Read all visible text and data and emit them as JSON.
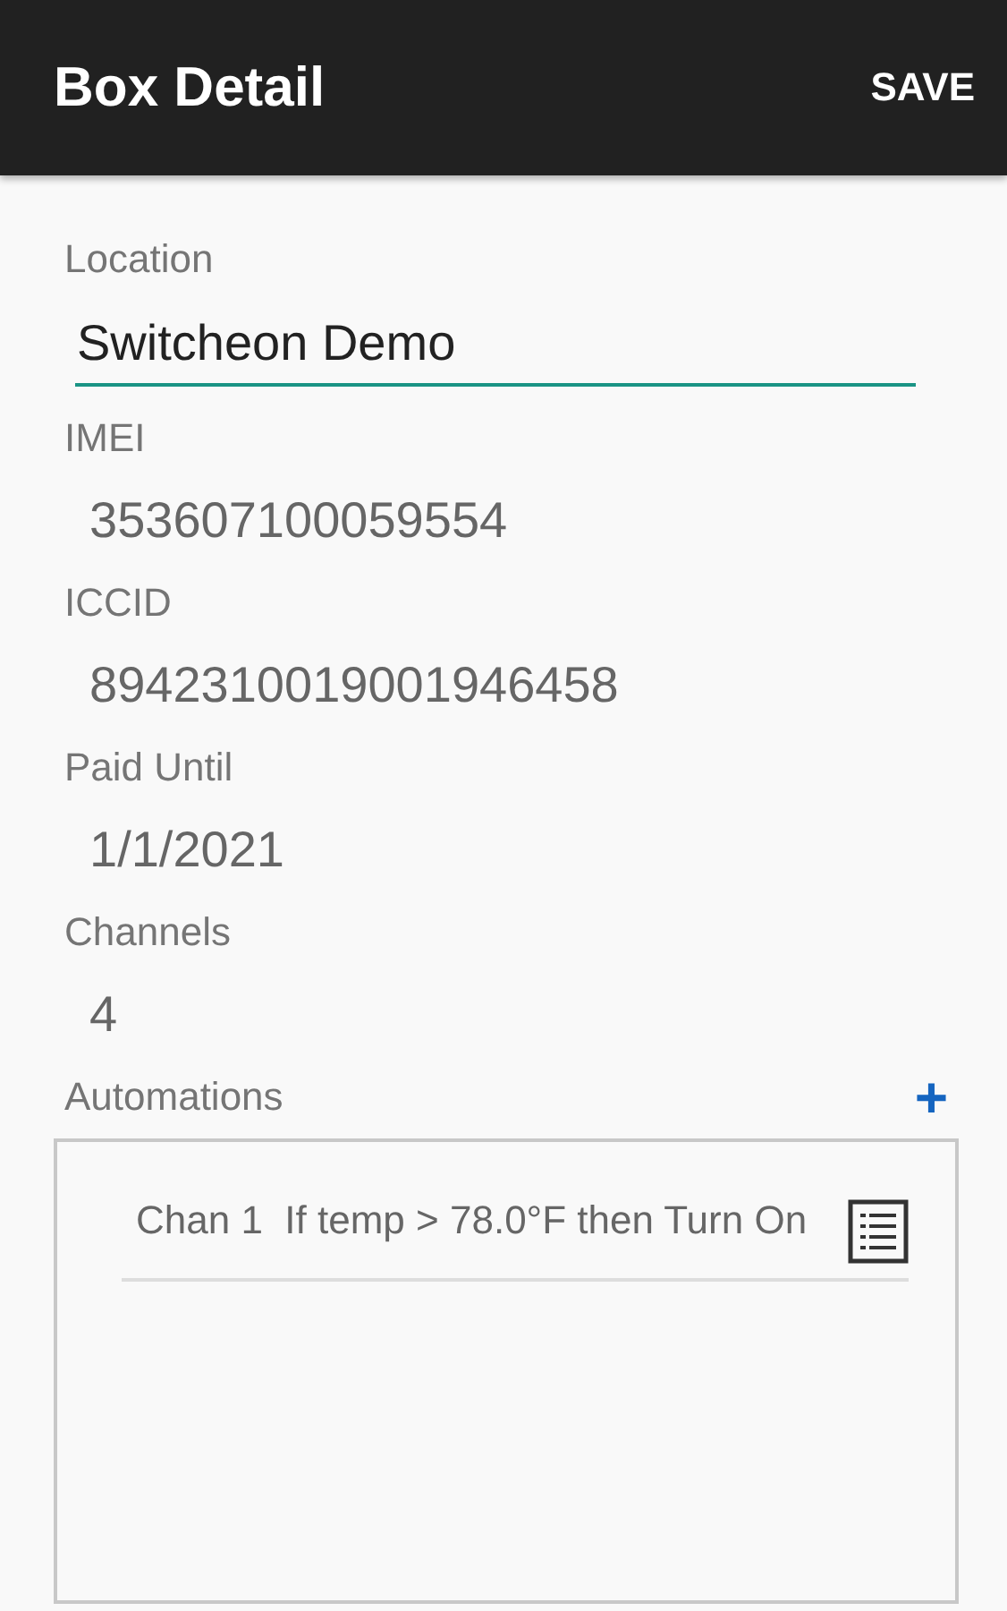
{
  "app_bar": {
    "title": "Box Detail",
    "action": "SAVE"
  },
  "fields": [
    {
      "label": "Location",
      "value": "Switcheon Demo",
      "kind": "input"
    },
    {
      "label": "IMEI",
      "value": "353607100059554",
      "kind": "text"
    },
    {
      "label": "ICCID",
      "value": "8942310019001946458",
      "kind": "text"
    },
    {
      "label": "Paid Until",
      "value": "1/1/2021",
      "kind": "text"
    },
    {
      "label": "Channels",
      "value": "4",
      "kind": "text"
    }
  ],
  "automations": {
    "label": "Automations",
    "add": "+",
    "items": [
      {
        "text": "Chan 1  If temp > 78.0°F then Turn On"
      }
    ]
  }
}
